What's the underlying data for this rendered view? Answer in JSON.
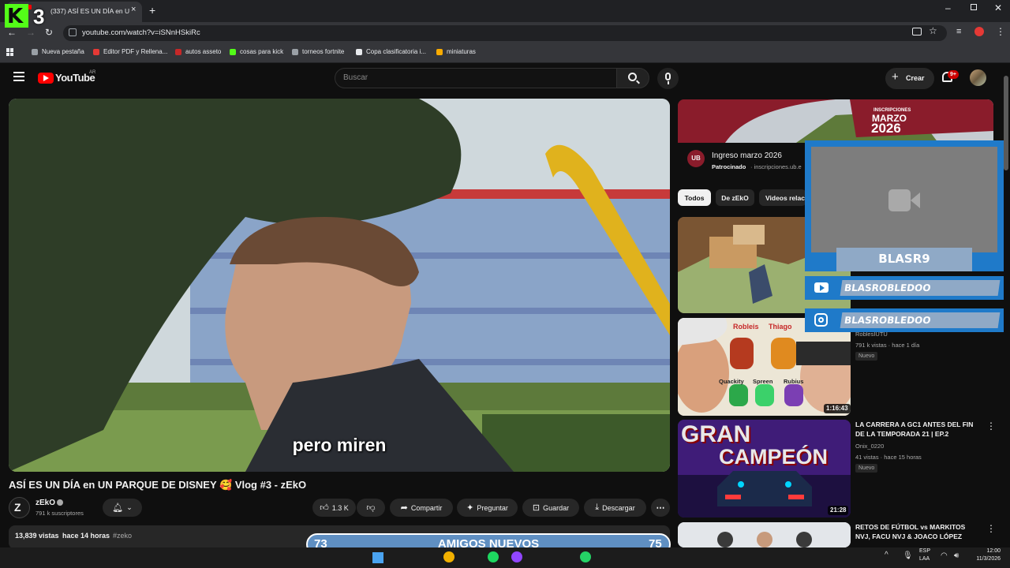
{
  "browser": {
    "tab_title": "(337) ASÍ ES UN DÍA en UN P",
    "url": "youtube.com/watch?v=iSNnHSkiRc",
    "bookmarks": [
      {
        "label": "Nueva pestaña",
        "color": "#9aa0a6"
      },
      {
        "label": "Editor PDF y Rellena...",
        "color": "#e53935"
      },
      {
        "label": "autos asseto",
        "color": "#c62828"
      },
      {
        "label": "cosas para kick",
        "color": "#53fc18"
      },
      {
        "label": "torneos fortnite",
        "color": "#9aa0a6"
      },
      {
        "label": "Copa clasificatoria i...",
        "color": "#e8eaed"
      },
      {
        "label": "miniaturas",
        "color": "#f9ab00"
      }
    ]
  },
  "stream_logo": {
    "number": "3"
  },
  "youtube": {
    "logo_text": "YouTube",
    "region": "AR",
    "search_placeholder": "Buscar",
    "create_label": "Crear",
    "notif_count": "9+"
  },
  "video": {
    "subtitle": "pero miren",
    "title": "ASÍ ES UN DÍA en UN PARQUE DE DISNEY 🥰 Vlog #3 - zEkO",
    "channel": "zEkO",
    "subscribers": "791 k suscriptores",
    "likes": "1.3 K",
    "share": "Compartir",
    "ask": "Preguntar",
    "save": "Guardar",
    "download": "Descargar",
    "views": "13,839 vistas",
    "time": "hace 14 horas",
    "hashtag": "#zeko"
  },
  "ad": {
    "banner_top": "INSCRIPCIONES",
    "banner_month": "MARZO",
    "banner_year": "2026",
    "title": "Ingreso marzo 2026",
    "sponsor_label": "Patrocinado",
    "domain": "· inscripciones.ub.e",
    "logo": "UB"
  },
  "chips": [
    "Todos",
    "De zEkO",
    "Videos relac"
  ],
  "sidebar_videos": [
    {
      "title": "",
      "channel": "RoblesIUTU",
      "meta": "791 k vistas · hace 1 día",
      "badge": "Nuevo",
      "duration": "1:16:43",
      "thumb_labels": [
        "Robleis",
        "Thiago",
        "Quackity",
        "Spreen",
        "Rubius"
      ]
    },
    {
      "title": "LA CARRERA A GC1 ANTES DEL FIN DE LA TEMPORADA 21 | EP.2",
      "channel": "Onix_0220",
      "meta": "41 vistas · hace 15 horas",
      "badge": "Nuevo",
      "duration": "21:28",
      "thumb_labels": [
        "GRAN",
        "CAMPEÓN"
      ]
    },
    {
      "title": "RETOS DE FÚTBOL vs MARKITOS NVJ, FACU NVJ & JOACO LÓPEZ",
      "channel": "",
      "meta": "",
      "badge": "",
      "duration": "",
      "thumb_labels": []
    }
  ],
  "overlay": {
    "cam_name": "BLASR9",
    "youtube_handle": "BLASROBLEDOO",
    "instagram_handle": "BLASROBLEDOO",
    "counter_left": "73",
    "counter_label": "AMIGOS NUEVOS",
    "counter_right": "75"
  },
  "taskbar": {
    "lang1": "ESP",
    "lang2": "LAA",
    "time": "12:00",
    "date": "11/3/2026"
  }
}
